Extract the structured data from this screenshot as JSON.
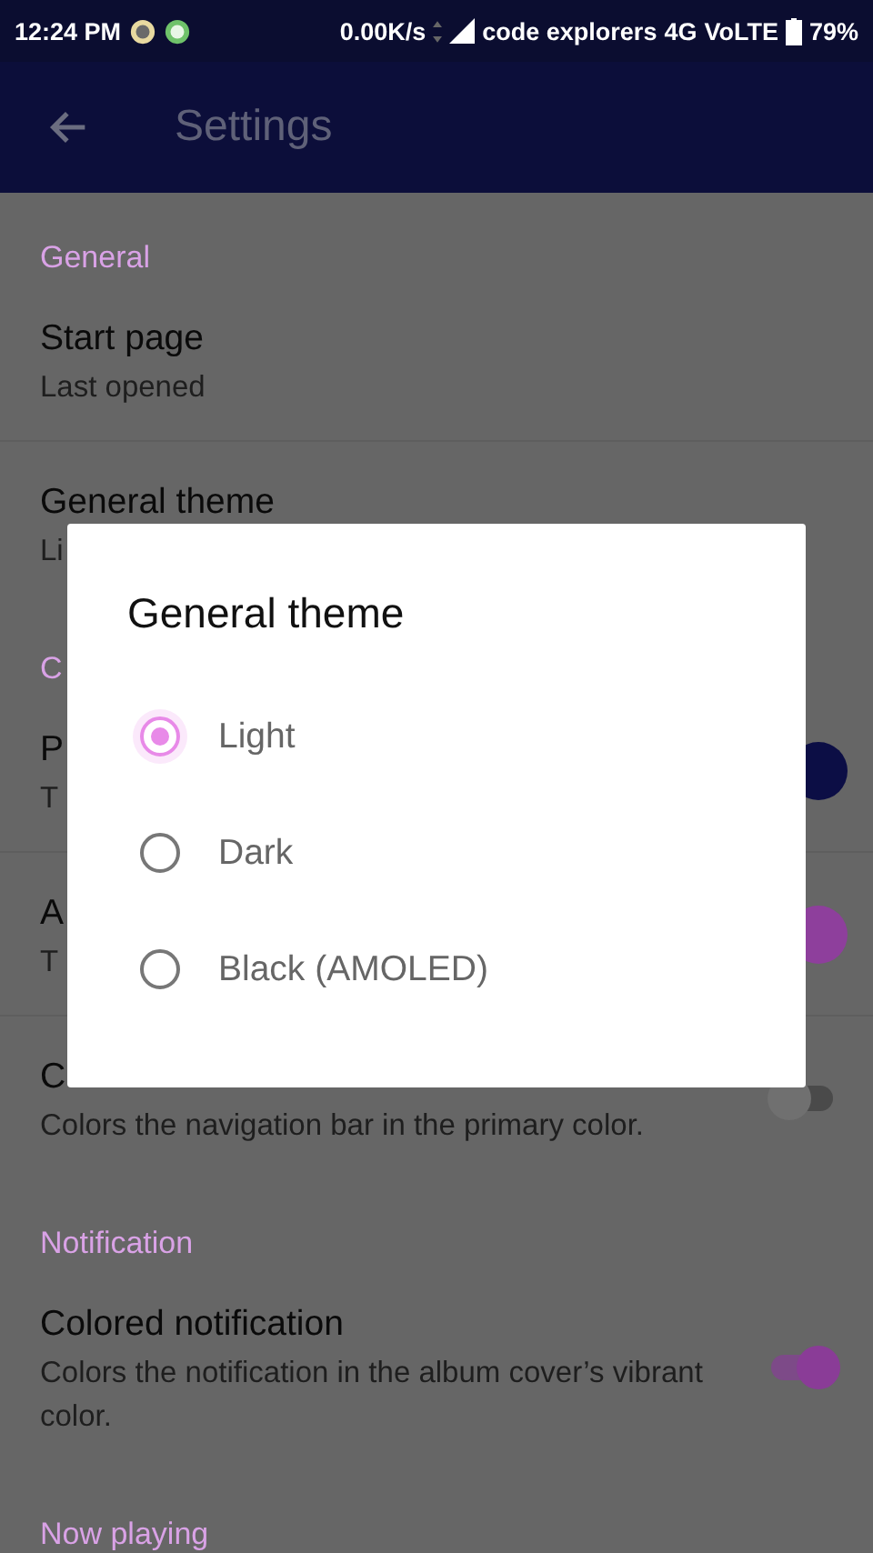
{
  "status_bar": {
    "time": "12:24 PM",
    "network_speed": "0.00K/s",
    "carrier": "code explorers",
    "network_type": "4G",
    "volte": "VoLTE",
    "battery": "79%"
  },
  "app_bar": {
    "title": "Settings"
  },
  "sections": [
    {
      "header": "General",
      "items": [
        {
          "kind": "text",
          "title": "Start page",
          "summary": "Last opened"
        },
        {
          "kind": "text",
          "title": "General theme",
          "summary": "Li"
        }
      ]
    },
    {
      "header": "C",
      "items": [
        {
          "kind": "color",
          "title": "P",
          "summary": "T",
          "color": "#0c0e45"
        },
        {
          "kind": "color",
          "title": "A",
          "summary": "T",
          "color": "#8e3f9c"
        },
        {
          "kind": "switch",
          "title": "C",
          "summary": "Colors the navigation bar in the primary color.",
          "on": false
        }
      ]
    },
    {
      "header": "Notification",
      "items": [
        {
          "kind": "switch",
          "title": "Colored notification",
          "summary": "Colors the notification in the album cover’s vibrant color.",
          "on": true
        }
      ]
    },
    {
      "header": "Now playing"
    }
  ],
  "dialog": {
    "title": "General theme",
    "options": [
      {
        "label": "Light",
        "selected": true
      },
      {
        "label": "Dark",
        "selected": false
      },
      {
        "label": "Black (AMOLED)",
        "selected": false
      }
    ]
  }
}
